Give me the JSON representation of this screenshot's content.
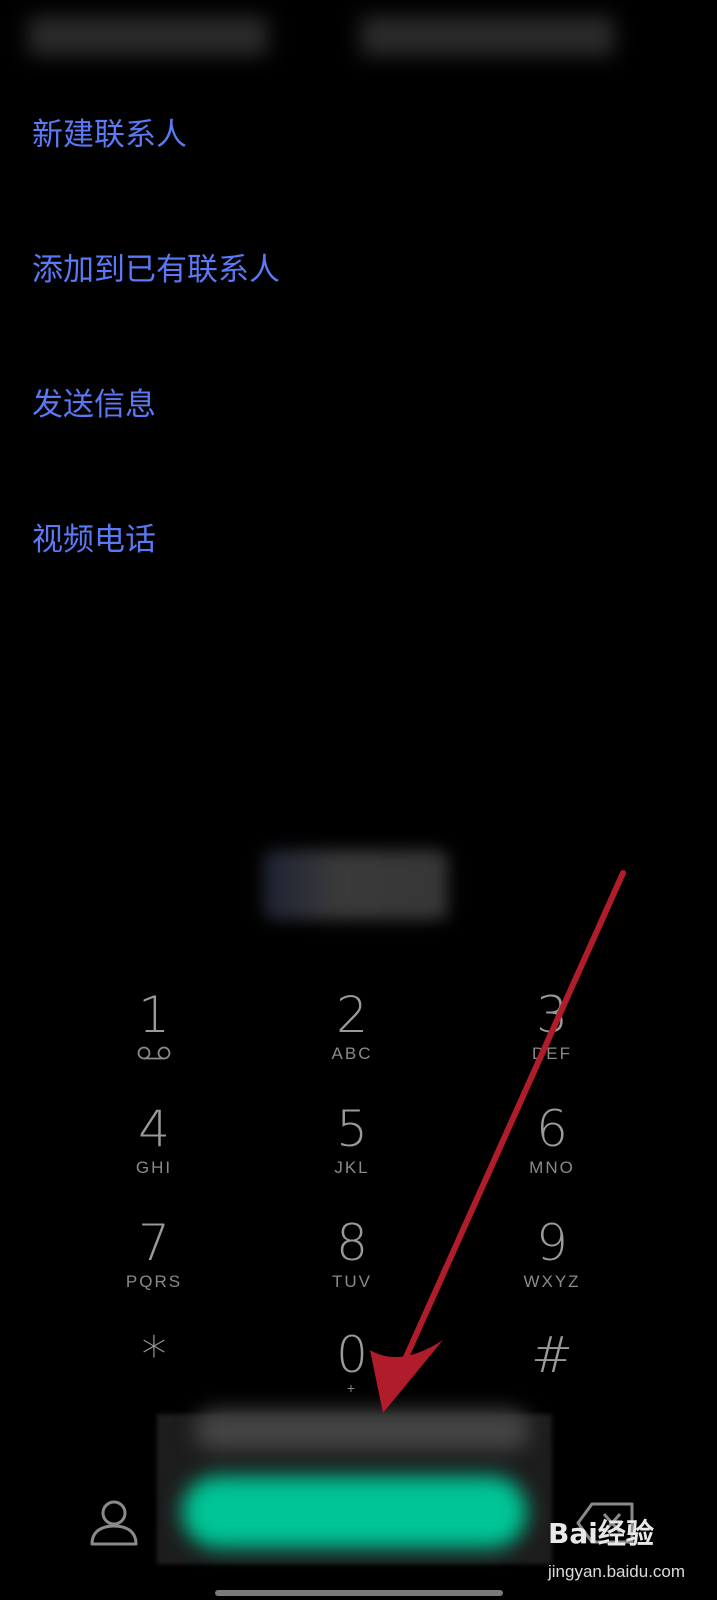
{
  "menu": {
    "items": [
      {
        "label": "新建联系人"
      },
      {
        "label": "添加到已有联系人"
      },
      {
        "label": "发送信息"
      },
      {
        "label": "视频电话"
      }
    ]
  },
  "keypad": {
    "keys": [
      {
        "digit": "1",
        "letters": "",
        "icon": "voicemail-icon"
      },
      {
        "digit": "2",
        "letters": "ABC"
      },
      {
        "digit": "3",
        "letters": "DEF"
      },
      {
        "digit": "4",
        "letters": "GHI"
      },
      {
        "digit": "5",
        "letters": "JKL"
      },
      {
        "digit": "6",
        "letters": "MNO"
      },
      {
        "digit": "7",
        "letters": "PQRS"
      },
      {
        "digit": "8",
        "letters": "TUV"
      },
      {
        "digit": "9",
        "letters": "WXYZ"
      },
      {
        "digit": "*",
        "letters": ""
      },
      {
        "digit": "0",
        "letters": "+"
      },
      {
        "digit": "#",
        "letters": ""
      }
    ]
  },
  "bottom_bar": {
    "left_icon": "contacts-icon",
    "right_icon": "delete-backspace-icon"
  },
  "watermark": {
    "logo": "Bai经验",
    "url": "jingyan.baidu.com"
  },
  "colors": {
    "background": "#000000",
    "menu_text": "#5b78f5",
    "key_text": "#9a9a9a",
    "call_button": "#00c596",
    "annotation_arrow": "#b01c2a"
  }
}
